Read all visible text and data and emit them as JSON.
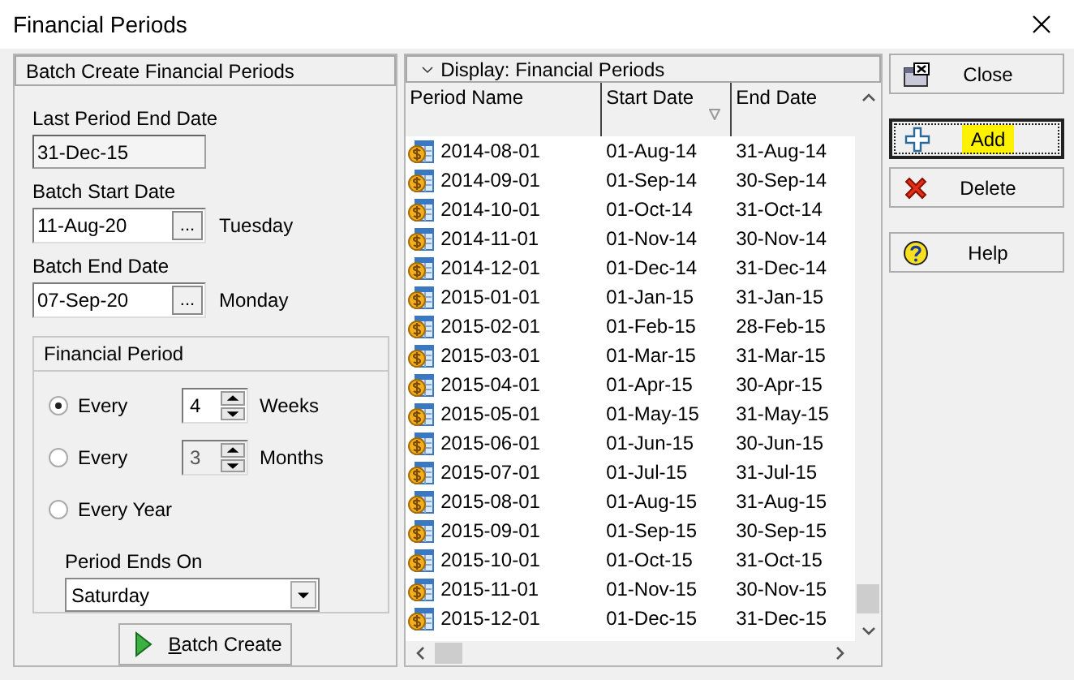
{
  "window": {
    "title": "Financial Periods"
  },
  "batch_panel": {
    "title": "Batch Create Financial Periods",
    "fields": [
      {
        "kind": "readonly",
        "label": "Last Period End Date",
        "value": "31-Dec-15"
      },
      {
        "kind": "date",
        "label": "Batch Start Date",
        "value": "11-Aug-20",
        "browse": "...",
        "day": "Tuesday"
      },
      {
        "kind": "date",
        "label": "Batch End Date",
        "value": "07-Sep-20",
        "browse": "...",
        "day": "Monday"
      }
    ],
    "financial_period": {
      "title": "Financial Period",
      "options": [
        {
          "label": "Every",
          "selected": true,
          "spin": {
            "value": "4",
            "disabled": false
          },
          "unit": "Weeks"
        },
        {
          "label": "Every",
          "selected": false,
          "spin": {
            "value": "3",
            "disabled": true
          },
          "unit": "Months"
        },
        {
          "label": "Every Year",
          "selected": false
        }
      ],
      "period_ends_on": {
        "label": "Period Ends On",
        "value": "Saturday"
      }
    },
    "batch_create_button": "Batch Create"
  },
  "grid": {
    "title": "Display: Financial Periods",
    "columns": [
      {
        "label": "Period Name",
        "sorted": false
      },
      {
        "label": "Start Date",
        "sorted": true
      },
      {
        "label": "End Date",
        "sorted": false
      }
    ],
    "rows": [
      [
        "2014-08-01",
        "01-Aug-14",
        "31-Aug-14"
      ],
      [
        "2014-09-01",
        "01-Sep-14",
        "30-Sep-14"
      ],
      [
        "2014-10-01",
        "01-Oct-14",
        "31-Oct-14"
      ],
      [
        "2014-11-01",
        "01-Nov-14",
        "30-Nov-14"
      ],
      [
        "2014-12-01",
        "01-Dec-14",
        "31-Dec-14"
      ],
      [
        "2015-01-01",
        "01-Jan-15",
        "31-Jan-15"
      ],
      [
        "2015-02-01",
        "01-Feb-15",
        "28-Feb-15"
      ],
      [
        "2015-03-01",
        "01-Mar-15",
        "31-Mar-15"
      ],
      [
        "2015-04-01",
        "01-Apr-15",
        "30-Apr-15"
      ],
      [
        "2015-05-01",
        "01-May-15",
        "31-May-15"
      ],
      [
        "2015-06-01",
        "01-Jun-15",
        "30-Jun-15"
      ],
      [
        "2015-07-01",
        "01-Jul-15",
        "31-Jul-15"
      ],
      [
        "2015-08-01",
        "01-Aug-15",
        "31-Aug-15"
      ],
      [
        "2015-09-01",
        "01-Sep-15",
        "30-Sep-15"
      ],
      [
        "2015-10-01",
        "01-Oct-15",
        "31-Oct-15"
      ],
      [
        "2015-11-01",
        "01-Nov-15",
        "30-Nov-15"
      ],
      [
        "2015-12-01",
        "01-Dec-15",
        "31-Dec-15"
      ]
    ]
  },
  "buttons": [
    {
      "kind": "close",
      "label": "Close",
      "focused": false,
      "highlighted": false
    },
    {
      "kind": "add",
      "label": "Add",
      "focused": true,
      "highlighted": true
    },
    {
      "kind": "delete",
      "label": "Delete",
      "focused": false,
      "highlighted": false
    },
    {
      "kind": "help",
      "label": "Help",
      "focused": false,
      "highlighted": false
    }
  ]
}
